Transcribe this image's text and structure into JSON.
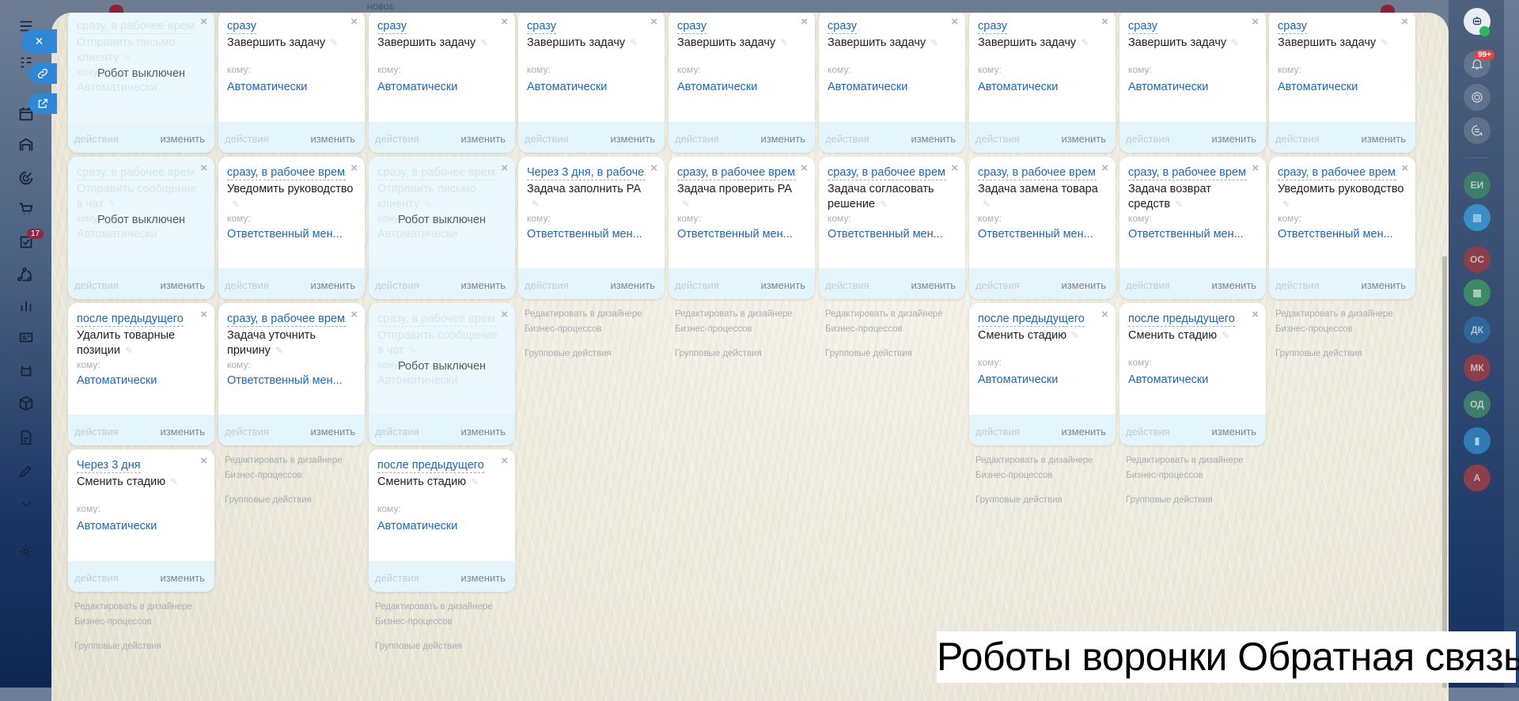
{
  "topbar": {
    "new_label": "НОВОЕ"
  },
  "left_sidebar": {
    "close_button": "×",
    "tasks_badge": "17",
    "icons": [
      "menu-icon",
      "crm-icon",
      "calendar-icon",
      "warehouse-icon",
      "target-icon",
      "cart-icon",
      "tasks-icon",
      "automation-icon",
      "analytics-icon",
      "contacts-icon",
      "robot-icon",
      "box-icon",
      "document-sign-icon",
      "signature-icon",
      "chevron-down-icon",
      "gear-icon"
    ]
  },
  "right_sidebar": {
    "notifications_badge": "99+",
    "chats": [
      {
        "label": "ЕИ",
        "color": "#3f7d6a"
      },
      {
        "label": "",
        "icon": "chat-icon",
        "color": "#3a8fc6"
      },
      {
        "label": "ОС",
        "color": "#8a3f4a"
      },
      {
        "label": "",
        "icon": "news-icon",
        "color": "#3f8a66"
      },
      {
        "label": "ДК",
        "color": "#31669a"
      },
      {
        "label": "МК",
        "color": "#8a3f4a"
      },
      {
        "label": "ОД",
        "color": "#3f7d6a"
      },
      {
        "label": "",
        "icon": "bookmark-icon",
        "color": "#2f7bb6"
      },
      {
        "label": "А",
        "color": "#8a3f4a"
      }
    ]
  },
  "labels": {
    "whom": "кому:",
    "actions": "действия",
    "edit": "изменить",
    "robot_off": "Робот выключен",
    "edit_in_designer_1": "Редактировать в дизайнере",
    "edit_in_designer_2": "Бизнес-процессов",
    "group_actions": "Групповые действия"
  },
  "columns": [
    {
      "cards": [
        {
          "off": true,
          "trigger": "сразу, в рабочее время",
          "title": "Отправить письмо клиенту",
          "assignee": "Автоматически"
        },
        {
          "off": true,
          "trigger": "сразу, в рабочее время",
          "title": "Отправить сообщение в чат",
          "assignee": "Автоматически"
        },
        {
          "off": false,
          "trigger": "после предыдущего",
          "title": "Удалить товарные позиции",
          "assignee": "Автоматически"
        },
        {
          "off": false,
          "trigger": "Через 3 дня",
          "title": "Сменить стадию",
          "assignee": "Автоматически"
        }
      ]
    },
    {
      "cards": [
        {
          "off": false,
          "trigger": "сразу",
          "title": "Завершить задачу",
          "assignee": "Автоматически"
        },
        {
          "off": false,
          "trigger": "сразу, в рабочее время",
          "title": "Уведомить руководство",
          "assignee": "Ответственный мен..."
        },
        {
          "off": false,
          "trigger": "сразу, в рабочее время",
          "title": "Задача уточнить причину",
          "assignee": "Ответственный мен..."
        }
      ]
    },
    {
      "cards": [
        {
          "off": false,
          "trigger": "сразу",
          "title": "Завершить задачу",
          "assignee": "Автоматически"
        },
        {
          "off": true,
          "trigger": "сразу, в рабочее время",
          "title": "Отправить письмо клиенту",
          "assignee": "Автоматически"
        },
        {
          "off": true,
          "trigger": "сразу, в рабочее врем...",
          "title": "Отправить сообщение в чат",
          "assignee": "Автоматически"
        },
        {
          "off": false,
          "trigger": "после предыдущего",
          "title": "Сменить стадию",
          "assignee": "Автоматически"
        }
      ]
    },
    {
      "cards": [
        {
          "off": false,
          "trigger": "сразу",
          "title": "Завершить задачу",
          "assignee": "Автоматически"
        },
        {
          "off": false,
          "trigger": "Через 3 дня, в рабоче...",
          "title": "Задача заполнить РА",
          "assignee": "Ответственный мен..."
        }
      ]
    },
    {
      "cards": [
        {
          "off": false,
          "trigger": "сразу",
          "title": "Завершить задачу",
          "assignee": "Автоматически"
        },
        {
          "off": false,
          "trigger": "сразу, в рабочее время",
          "title": "Задача проверить РА",
          "assignee": "Ответственный мен..."
        }
      ]
    },
    {
      "cards": [
        {
          "off": false,
          "trigger": "сразу",
          "title": "Завершить задачу",
          "assignee": "Автоматически"
        },
        {
          "off": false,
          "trigger": "сразу, в рабочее врем...",
          "title": "Задача согласовать решение",
          "assignee": "Ответственный мен..."
        }
      ]
    },
    {
      "cards": [
        {
          "off": false,
          "trigger": "сразу",
          "title": "Завершить задачу",
          "assignee": "Автоматически"
        },
        {
          "off": false,
          "trigger": "сразу, в рабочее врем...",
          "title": "Задача замена товара",
          "assignee": "Ответственный мен..."
        },
        {
          "off": false,
          "trigger": "после предыдущего",
          "title": "Сменить стадию",
          "assignee": "Автоматически"
        }
      ]
    },
    {
      "cards": [
        {
          "off": false,
          "trigger": "сразу",
          "title": "Завершить задачу",
          "assignee": "Автоматически"
        },
        {
          "off": false,
          "trigger": "сразу, в рабочее врем...",
          "title": "Задача возврат средств",
          "assignee": "Ответственный мен..."
        },
        {
          "off": false,
          "trigger": "после предыдущего",
          "title": "Сменить стадию",
          "assignee": "Автоматически"
        }
      ]
    },
    {
      "cards": [
        {
          "off": false,
          "trigger": "сразу",
          "title": "Завершить задачу",
          "assignee": "Автоматически"
        },
        {
          "off": false,
          "trigger": "сразу, в рабочее время",
          "title": "Уведомить руководство",
          "assignee": "Ответственный мен..."
        }
      ]
    }
  ],
  "caption": "Роботы воронки Обратная связь"
}
